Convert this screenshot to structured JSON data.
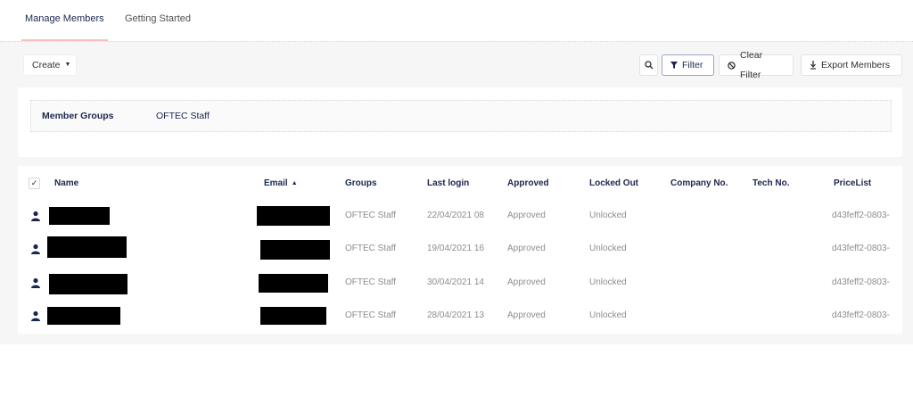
{
  "tabs": [
    {
      "label": "Manage Members",
      "active": true
    },
    {
      "label": "Getting Started",
      "active": false
    }
  ],
  "toolbar": {
    "create_label": "Create",
    "filter_label": "Filter",
    "clear_filter_label": "Clear Filter",
    "export_label": "Export Members"
  },
  "filter": {
    "label": "Member Groups",
    "value": "OFTEC Staff"
  },
  "table": {
    "headers": {
      "name": "Name",
      "email": "Email",
      "groups": "Groups",
      "last_login": "Last login",
      "approved": "Approved",
      "locked_out": "Locked Out",
      "company_no": "Company No.",
      "tech_no": "Tech No.",
      "pricelist": "PriceList"
    },
    "rows": [
      {
        "groups": "OFTEC Staff",
        "last_login": "22/04/2021 08",
        "approved": "Approved",
        "locked_out": "Unlocked",
        "company_no": "",
        "tech_no": "",
        "pricelist": "d43feff2-0803-"
      },
      {
        "groups": "OFTEC Staff",
        "last_login": "19/04/2021 16",
        "approved": "Approved",
        "locked_out": "Unlocked",
        "company_no": "",
        "tech_no": "",
        "pricelist": "d43feff2-0803-"
      },
      {
        "groups": "OFTEC Staff",
        "last_login": "30/04/2021 14",
        "approved": "Approved",
        "locked_out": "Unlocked",
        "company_no": "",
        "tech_no": "",
        "pricelist": "d43feff2-0803-"
      },
      {
        "groups": "OFTEC Staff",
        "last_login": "28/04/2021 13",
        "approved": "Approved",
        "locked_out": "Unlocked",
        "company_no": "",
        "tech_no": "",
        "pricelist": "d43feff2-0803-"
      }
    ]
  },
  "icons": {
    "caret": "caret-down-icon",
    "search": "search-icon",
    "filter": "filter-icon",
    "clear": "block-icon",
    "export": "download-icon",
    "sort": "sort-asc-icon",
    "member": "user-icon",
    "check": "check-icon"
  },
  "colors": {
    "primary": "#1b264f",
    "tab_underline": "#f5c1bc",
    "muted_text": "#8d8c91",
    "workspace_bg": "#f6f6f7",
    "filter_border": "#9aa5c7"
  }
}
